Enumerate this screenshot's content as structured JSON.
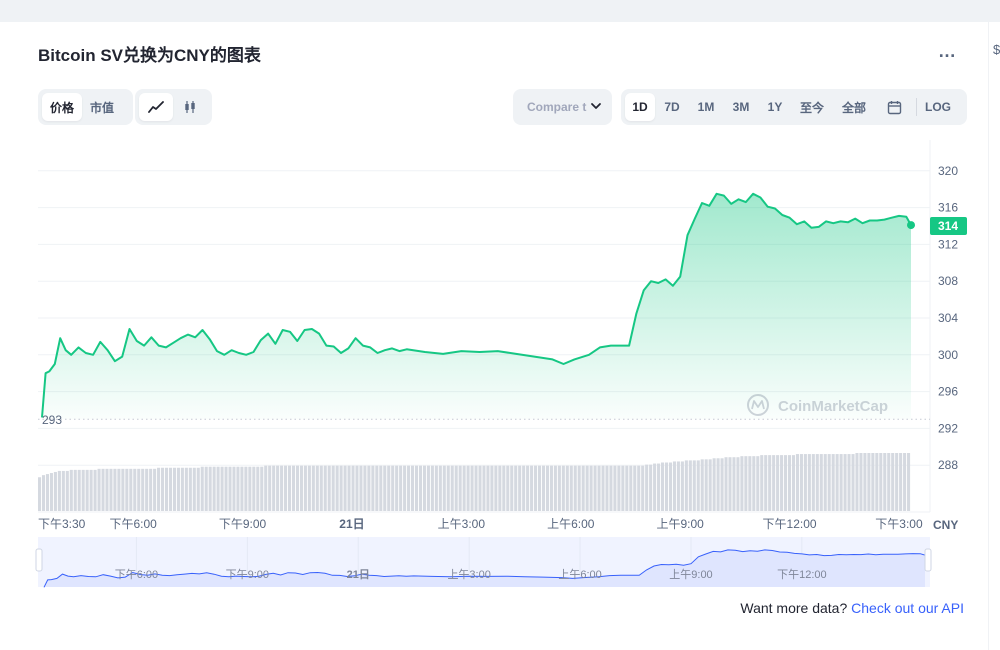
{
  "title": "Bitcoin SV兑换为CNY的图表",
  "type_tabs": [
    "价格",
    "市值"
  ],
  "range_tabs": [
    "1D",
    "7D",
    "1M",
    "3M",
    "1Y",
    "至今",
    "全部"
  ],
  "active_range": "1D",
  "compare_label": "Compare t",
  "log_label": "LOG",
  "footer_text": "Want more data?",
  "footer_link": "Check out our API",
  "watermark": "CoinMarketCap",
  "colors": {
    "line": "#16c784",
    "accent": "#3861fb",
    "nav_line": "#3861fb"
  },
  "chart_data": {
    "type": "area",
    "y_ticks": [
      "320",
      "316",
      "312",
      "308",
      "304",
      "300",
      "296",
      "292",
      "288"
    ],
    "ylim": [
      286.5,
      321.5
    ],
    "x_ticks": [
      {
        "t": 0,
        "label": "下午3:30"
      },
      {
        "t": 2.5,
        "label": "下午6:00"
      },
      {
        "t": 5.5,
        "label": "下午9:00"
      },
      {
        "t": 8.5,
        "label": "21日"
      },
      {
        "t": 11.5,
        "label": "上午3:00"
      },
      {
        "t": 14.5,
        "label": "上午6:00"
      },
      {
        "t": 17.5,
        "label": "上午9:00"
      },
      {
        "t": 20.5,
        "label": "下午12:00"
      },
      {
        "t": 23.5,
        "label": "下午3:00"
      }
    ],
    "xlim": [
      0,
      23.83
    ],
    "x_unit_label": "CNY",
    "current_price": "314",
    "open_price_label": "293",
    "open_price": 293.0,
    "series": [
      {
        "x": [
          0,
          0.1,
          0.2,
          0.35,
          0.5,
          0.65,
          0.8,
          1.0,
          1.2,
          1.4,
          1.6,
          1.8,
          2.0,
          2.2,
          2.4,
          2.6,
          2.8,
          3.0,
          3.2,
          3.4,
          3.6,
          3.8,
          4.0,
          4.2,
          4.4,
          4.6,
          4.8,
          5.0,
          5.2,
          5.4,
          5.6,
          5.8,
          6.0,
          6.2,
          6.4,
          6.6,
          6.8,
          7.0,
          7.2,
          7.4,
          7.6,
          7.8,
          8.0,
          8.2,
          8.4,
          8.6,
          8.8,
          9.0,
          9.2,
          9.4,
          9.6,
          9.8,
          10.0,
          10.5,
          11.0,
          11.5,
          12.0,
          12.5,
          13.0,
          13.5,
          14.0,
          14.3,
          14.6,
          15.0,
          15.3,
          15.6,
          15.9,
          16.1,
          16.3,
          16.5,
          16.7,
          16.9,
          17.1,
          17.3,
          17.5,
          17.7,
          17.9,
          18.1,
          18.3,
          18.5,
          18.7,
          18.9,
          19.1,
          19.3,
          19.5,
          19.7,
          19.9,
          20.1,
          20.3,
          20.5,
          20.7,
          20.9,
          21.1,
          21.3,
          21.5,
          21.7,
          21.9,
          22.1,
          22.3,
          22.5,
          22.7,
          22.9,
          23.1,
          23.3,
          23.5,
          23.7,
          23.83
        ],
        "y": [
          293.2,
          298.0,
          298.2,
          299.0,
          301.8,
          300.5,
          300.0,
          300.8,
          300.2,
          300.0,
          301.4,
          300.5,
          299.3,
          299.8,
          302.8,
          301.5,
          301.0,
          301.9,
          301.0,
          300.8,
          301.3,
          301.8,
          302.2,
          301.9,
          302.7,
          301.7,
          300.4,
          300.0,
          300.5,
          300.2,
          300.0,
          300.3,
          301.6,
          302.3,
          301.2,
          302.7,
          302.5,
          301.5,
          302.7,
          302.8,
          302.3,
          301.0,
          300.9,
          300.2,
          300.7,
          301.8,
          301.0,
          300.8,
          300.2,
          300.5,
          300.7,
          300.4,
          300.6,
          300.3,
          300.1,
          300.4,
          300.3,
          300.4,
          300.1,
          299.8,
          299.5,
          299.0,
          299.5,
          300.0,
          300.8,
          301.0,
          301.0,
          301.0,
          304.5,
          307.0,
          308.0,
          307.8,
          308.2,
          307.5,
          308.5,
          313.0,
          314.8,
          316.5,
          316.2,
          317.5,
          317.3,
          316.4,
          316.9,
          316.6,
          317.5,
          317.1,
          316.1,
          315.9,
          315.2,
          314.9,
          314.2,
          314.5,
          313.8,
          313.9,
          314.5,
          314.3,
          314.5,
          314.4,
          314.8,
          314.3,
          314.6,
          314.6,
          314.7,
          314.9,
          315.1,
          315.0,
          314.1
        ]
      }
    ],
    "volume": [
      3.2,
      3.4,
      3.5,
      3.6,
      3.7,
      3.8,
      3.8,
      3.8,
      3.9,
      3.9,
      3.9,
      3.9,
      3.9,
      3.9,
      3.9,
      4.0,
      4.0,
      4.0,
      4.0,
      4.0,
      4.0,
      4.0,
      4.0,
      4.0,
      4.0,
      4.0,
      4.0,
      4.0,
      4.0,
      4.0,
      4.1,
      4.1,
      4.1,
      4.1,
      4.1,
      4.1,
      4.1,
      4.1,
      4.1,
      4.1,
      4.1,
      4.2,
      4.2,
      4.2,
      4.2,
      4.2,
      4.2,
      4.2,
      4.2,
      4.2,
      4.2,
      4.2,
      4.2,
      4.2,
      4.2,
      4.2,
      4.2,
      4.3,
      4.3,
      4.3,
      4.3,
      4.3,
      4.3,
      4.3,
      4.3,
      4.3,
      4.3,
      4.3,
      4.3,
      4.3,
      4.3,
      4.3,
      4.3,
      4.3,
      4.3,
      4.3,
      4.3,
      4.3,
      4.3,
      4.3,
      4.3,
      4.3,
      4.3,
      4.3,
      4.3,
      4.3,
      4.3,
      4.3,
      4.3,
      4.3,
      4.3,
      4.3,
      4.3,
      4.3,
      4.3,
      4.3,
      4.3,
      4.3,
      4.3,
      4.3,
      4.3,
      4.3,
      4.3,
      4.3,
      4.3,
      4.3,
      4.3,
      4.3,
      4.3,
      4.3,
      4.3,
      4.3,
      4.3,
      4.3,
      4.3,
      4.3,
      4.3,
      4.3,
      4.3,
      4.3,
      4.3,
      4.3,
      4.3,
      4.3,
      4.3,
      4.3,
      4.3,
      4.3,
      4.3,
      4.3,
      4.3,
      4.3,
      4.3,
      4.3,
      4.3,
      4.3,
      4.3,
      4.3,
      4.3,
      4.3,
      4.3,
      4.3,
      4.3,
      4.3,
      4.3,
      4.3,
      4.3,
      4.3,
      4.3,
      4.3,
      4.3,
      4.3,
      4.3,
      4.4,
      4.4,
      4.5,
      4.5,
      4.6,
      4.6,
      4.6,
      4.7,
      4.7,
      4.7,
      4.8,
      4.8,
      4.8,
      4.8,
      4.9,
      4.9,
      4.9,
      5.0,
      5.0,
      5.0,
      5.1,
      5.1,
      5.1,
      5.1,
      5.2,
      5.2,
      5.2,
      5.2,
      5.2,
      5.3,
      5.3,
      5.3,
      5.3,
      5.3,
      5.3,
      5.3,
      5.3,
      5.3,
      5.4,
      5.4,
      5.4,
      5.4,
      5.4,
      5.4,
      5.4,
      5.4,
      5.4,
      5.4,
      5.4,
      5.4,
      5.4,
      5.4,
      5.4,
      5.5,
      5.5,
      5.5,
      5.5,
      5.5,
      5.5,
      5.5,
      5.5,
      5.5,
      5.5,
      5.5,
      5.5,
      5.5,
      5.5
    ]
  },
  "navigator": {
    "labels": [
      {
        "t": 2.5,
        "label": "下午6:00"
      },
      {
        "t": 5.5,
        "label": "下午9:00"
      },
      {
        "t": 8.5,
        "label": "21日"
      },
      {
        "t": 11.5,
        "label": "上午3:00"
      },
      {
        "t": 14.5,
        "label": "上午6:00"
      },
      {
        "t": 17.5,
        "label": "上午9:00"
      },
      {
        "t": 20.5,
        "label": "下午12:00"
      }
    ]
  }
}
